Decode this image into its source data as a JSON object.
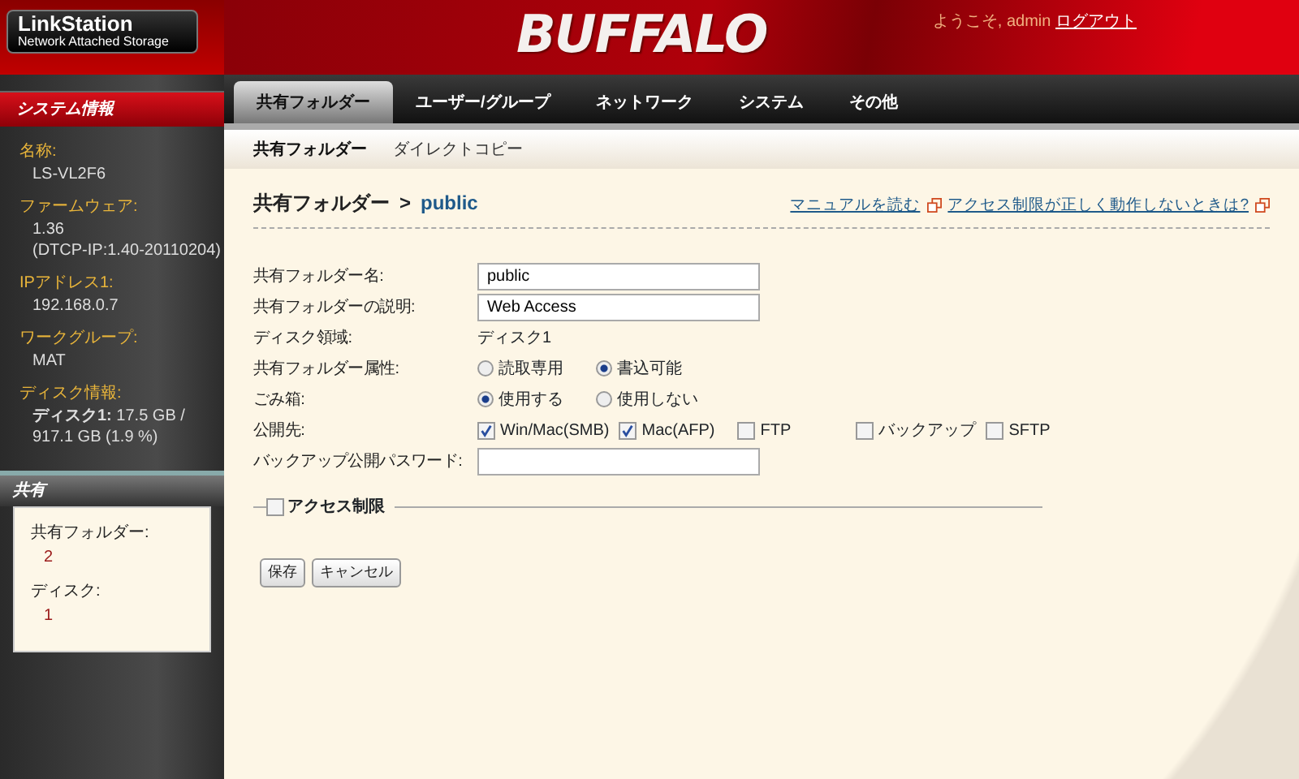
{
  "header": {
    "logo_title": "LinkStation",
    "logo_subtitle": "Network Attached Storage",
    "brand": "BUFFALO",
    "welcome": "ようこそ, admin",
    "logout": "ログアウト"
  },
  "sidebar": {
    "system_info": {
      "title": "システム情報",
      "items": [
        {
          "label": "名称:",
          "values": [
            "LS-VL2F6"
          ]
        },
        {
          "label": "ファームウェア:",
          "values": [
            "1.36",
            "(DTCP-IP:1.40-20110204)"
          ]
        },
        {
          "label": "IPアドレス1:",
          "values": [
            "192.168.0.7"
          ]
        },
        {
          "label": "ワークグループ:",
          "values": [
            "MAT"
          ]
        },
        {
          "label": "ディスク情報:",
          "values": [
            "**ディスク1:** 17.5 GB / 917.1 GB (1.9 %)"
          ]
        }
      ]
    },
    "shared": {
      "title": "共有",
      "items": [
        {
          "label": "共有フォルダー:",
          "value": "2"
        },
        {
          "label": "ディスク:",
          "value": "1"
        }
      ]
    }
  },
  "tabs": [
    {
      "label": "共有フォルダー",
      "selected": true
    },
    {
      "label": "ユーザー/グループ",
      "selected": false
    },
    {
      "label": "ネットワーク",
      "selected": false
    },
    {
      "label": "システム",
      "selected": false
    },
    {
      "label": "その他",
      "selected": false
    }
  ],
  "subtabs": [
    {
      "label": "共有フォルダー",
      "selected": true
    },
    {
      "label": "ダイレクトコピー",
      "selected": false
    }
  ],
  "breadcrumb": {
    "parent": "共有フォルダー",
    "separator": ">",
    "current": "public"
  },
  "help_links": [
    "マニュアルを読む",
    "アクセス制限が正しく動作しないときは?"
  ],
  "form": [
    {
      "kind": "text",
      "label": "共有フォルダー名:",
      "value": "public"
    },
    {
      "kind": "text",
      "label": "共有フォルダーの説明:",
      "value": "Web Access"
    },
    {
      "kind": "static",
      "label": "ディスク領域:",
      "value": "ディスク1"
    },
    {
      "kind": "radio",
      "label": "共有フォルダー属性:",
      "options": [
        {
          "label": "読取専用",
          "selected": false
        },
        {
          "label": "書込可能",
          "selected": true
        }
      ]
    },
    {
      "kind": "radio",
      "label": "ごみ箱:",
      "options": [
        {
          "label": "使用する",
          "selected": true
        },
        {
          "label": "使用しない",
          "selected": false
        }
      ]
    },
    {
      "kind": "checkbox",
      "label": "公開先:",
      "options": [
        {
          "label": "Win/Mac(SMB)",
          "checked": true
        },
        {
          "label": "Mac(AFP)",
          "checked": true
        },
        {
          "label": "FTP",
          "checked": false
        },
        {
          "label": "バックアップ",
          "checked": false
        },
        {
          "label": "SFTP",
          "checked": false
        }
      ]
    },
    {
      "kind": "password",
      "label": "バックアップ公開パスワード:"
    }
  ],
  "access_restriction": {
    "label": "アクセス制限",
    "checked": false
  },
  "buttons": [
    "保存",
    "キャンセル"
  ]
}
